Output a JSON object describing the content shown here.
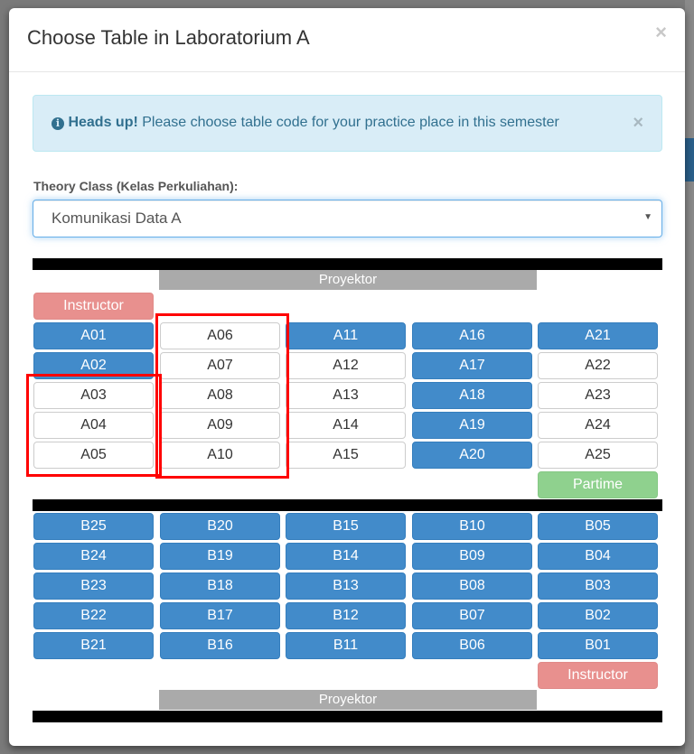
{
  "modal": {
    "title": "Choose Table in Laboratorium A",
    "close_label": "×"
  },
  "alert": {
    "icon": "info-circle-icon",
    "heading": "Heads up!",
    "message": " Please choose table code for your practice place in this semester",
    "close_label": "×"
  },
  "form": {
    "label": "Theory Class (Kelas Perkuliahan):",
    "selected_class": "Komunikasi Data A",
    "caret": "▼"
  },
  "room_a": {
    "projector_label": "Proyektor",
    "instructor_label": "Instructor",
    "partime_label": "Partime",
    "columns": [
      [
        {
          "code": "A01",
          "status": "occupied"
        },
        {
          "code": "A02",
          "status": "occupied"
        },
        {
          "code": "A03",
          "status": "available"
        },
        {
          "code": "A04",
          "status": "available"
        },
        {
          "code": "A05",
          "status": "available"
        }
      ],
      [
        {
          "code": "A06",
          "status": "available"
        },
        {
          "code": "A07",
          "status": "available"
        },
        {
          "code": "A08",
          "status": "available"
        },
        {
          "code": "A09",
          "status": "available"
        },
        {
          "code": "A10",
          "status": "available"
        }
      ],
      [
        {
          "code": "A11",
          "status": "occupied"
        },
        {
          "code": "A12",
          "status": "available"
        },
        {
          "code": "A13",
          "status": "available"
        },
        {
          "code": "A14",
          "status": "available"
        },
        {
          "code": "A15",
          "status": "available"
        }
      ],
      [
        {
          "code": "A16",
          "status": "occupied"
        },
        {
          "code": "A17",
          "status": "occupied"
        },
        {
          "code": "A18",
          "status": "occupied"
        },
        {
          "code": "A19",
          "status": "occupied"
        },
        {
          "code": "A20",
          "status": "occupied"
        }
      ],
      [
        {
          "code": "A21",
          "status": "occupied"
        },
        {
          "code": "A22",
          "status": "available"
        },
        {
          "code": "A23",
          "status": "available"
        },
        {
          "code": "A24",
          "status": "available"
        },
        {
          "code": "A25",
          "status": "available"
        }
      ]
    ]
  },
  "room_b": {
    "projector_label": "Proyektor",
    "instructor_label": "Instructor",
    "rows": [
      [
        "B25",
        "B20",
        "B15",
        "B10",
        "B05"
      ],
      [
        "B24",
        "B19",
        "B14",
        "B09",
        "B04"
      ],
      [
        "B23",
        "B18",
        "B13",
        "B08",
        "B03"
      ],
      [
        "B22",
        "B17",
        "B12",
        "B07",
        "B02"
      ],
      [
        "B21",
        "B16",
        "B11",
        "B06",
        "B01"
      ]
    ]
  },
  "colors": {
    "occupied": "#428bca",
    "available": "#ffffff",
    "instructor": "#e8908e",
    "partime": "#8fd18e",
    "highlight": "#ff0000"
  }
}
